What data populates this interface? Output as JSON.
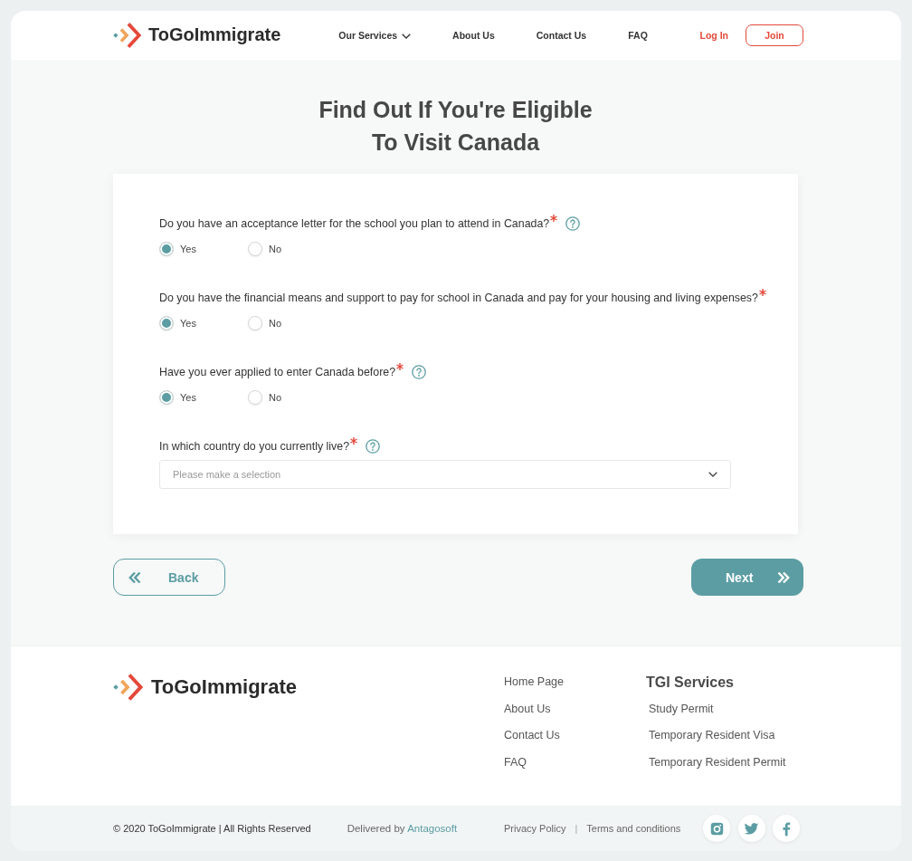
{
  "header": {
    "brand": "ToGoImmigrate",
    "nav": [
      {
        "label": "Our Services",
        "dropdown": true
      },
      {
        "label": "About Us",
        "dropdown": false
      },
      {
        "label": "Contact Us",
        "dropdown": false
      },
      {
        "label": "FAQ",
        "dropdown": false
      }
    ],
    "login": "Log In",
    "join": "Join"
  },
  "title_lines": [
    "Find Out If You're Eligible",
    "To Visit Canada"
  ],
  "form": {
    "questions": [
      {
        "kind": "radio",
        "text": "Do you have an acceptance letter for the school you plan to attend in Canada?",
        "required": true,
        "help": true,
        "options": [
          {
            "label": "Yes",
            "selected": true
          },
          {
            "label": "No",
            "selected": false
          }
        ]
      },
      {
        "kind": "radio",
        "text": "Do you have the financial means and support to pay for school in Canada and pay for your housing and living expenses?",
        "required": true,
        "help": false,
        "options": [
          {
            "label": "Yes",
            "selected": true
          },
          {
            "label": "No",
            "selected": false
          }
        ]
      },
      {
        "kind": "radio",
        "text": "Have you ever applied to enter Canada before?",
        "required": true,
        "help": true,
        "options": [
          {
            "label": "Yes",
            "selected": true
          },
          {
            "label": "No",
            "selected": false
          }
        ]
      },
      {
        "kind": "select",
        "text": "In which country do you currently live?",
        "required": true,
        "help": true,
        "placeholder": "Please make a selection"
      }
    ]
  },
  "actions": {
    "back": "Back",
    "next": "Next"
  },
  "footer": {
    "brand": "ToGoImmigrate",
    "links": [
      "Home Page",
      "About Us",
      "Contact Us",
      "FAQ"
    ],
    "services_title": "TGI Services",
    "services": [
      "Study Permit",
      "Temporary Resident Visa",
      "Temporary Resident Permit"
    ]
  },
  "bottom_bar": {
    "copyright": "© 2020 ToGoImmigrate | All Rights Reserved",
    "delivered_by": "Delivered by",
    "delivered_link": "Antagosoft",
    "legal_links": [
      "Privacy Policy",
      "Terms and conditions"
    ],
    "separator": "|"
  }
}
